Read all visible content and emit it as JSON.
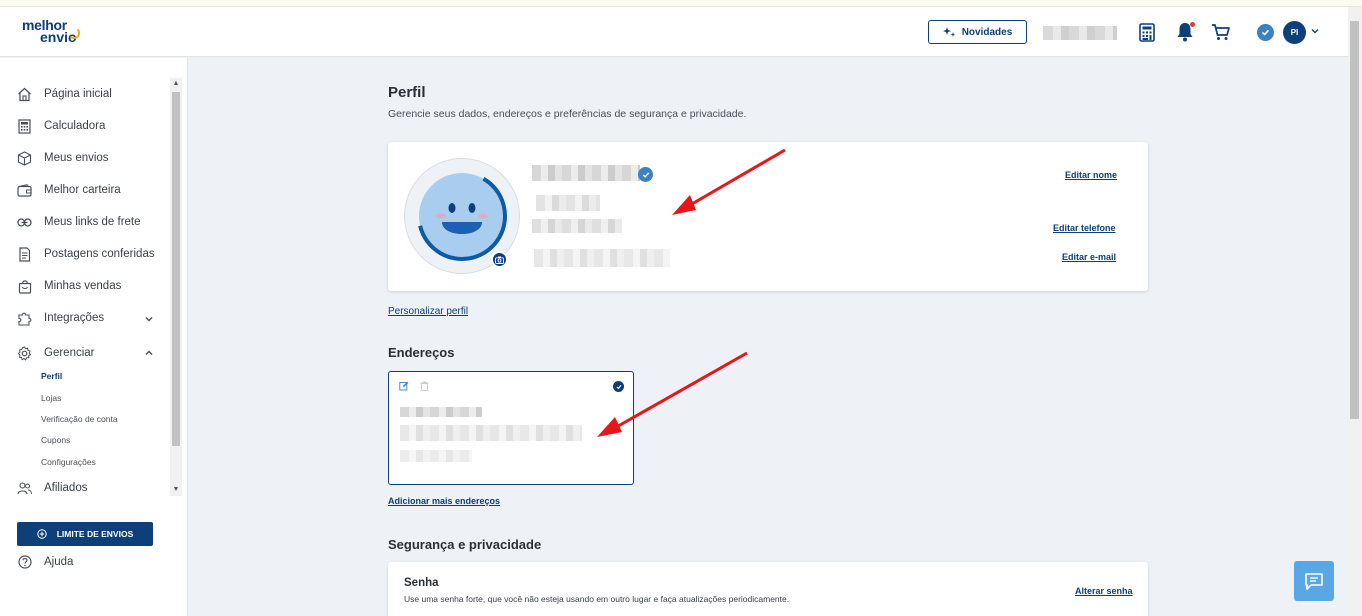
{
  "header": {
    "logo_line1": "melhor",
    "logo_line2": "envio",
    "novidades_label": "Novidades",
    "avatar_initials": "PI"
  },
  "sidebar": {
    "items": [
      {
        "label": "Página inicial",
        "icon": "home-icon"
      },
      {
        "label": "Calculadora",
        "icon": "calculator-icon"
      },
      {
        "label": "Meus envios",
        "icon": "box-icon"
      },
      {
        "label": "Melhor carteira",
        "icon": "wallet-icon"
      },
      {
        "label": "Meus links de frete",
        "icon": "link-icon"
      },
      {
        "label": "Postagens conferidas",
        "icon": "document-icon"
      },
      {
        "label": "Minhas vendas",
        "icon": "bag-icon"
      },
      {
        "label": "Integrações",
        "icon": "puzzle-icon"
      },
      {
        "label": "Gerenciar",
        "icon": "gear-icon"
      }
    ],
    "gerenciar_sub": [
      "Perfil",
      "Lojas",
      "Verificação de conta",
      "Cupons",
      "Configurações"
    ],
    "afiliados_label": "Afiliados",
    "limite_label": "LIMITE DE ENVIOS",
    "ajuda_label": "Ajuda"
  },
  "main": {
    "title": "Perfil",
    "subtitle": "Gerencie seus dados, endereços e preferências de segurança e privacidade.",
    "edit_name": "Editar nome",
    "edit_phone": "Editar telefone",
    "edit_email": "Editar e-mail",
    "personalizar": "Personalizar perfil",
    "enderecos_title": "Endereços",
    "add_address": "Adicionar mais endereços",
    "seguranca_title": "Segurança e privacidade",
    "senha_title": "Senha",
    "senha_desc": "Use uma senha forte, que você não esteja usando em outro lugar e faça atualizações periodicamente.",
    "alterar_senha": "Alterar senha"
  },
  "colors": {
    "brand": "#0d3f79",
    "accent": "#3b82c4",
    "annotation_arrow": "#e8161b"
  }
}
